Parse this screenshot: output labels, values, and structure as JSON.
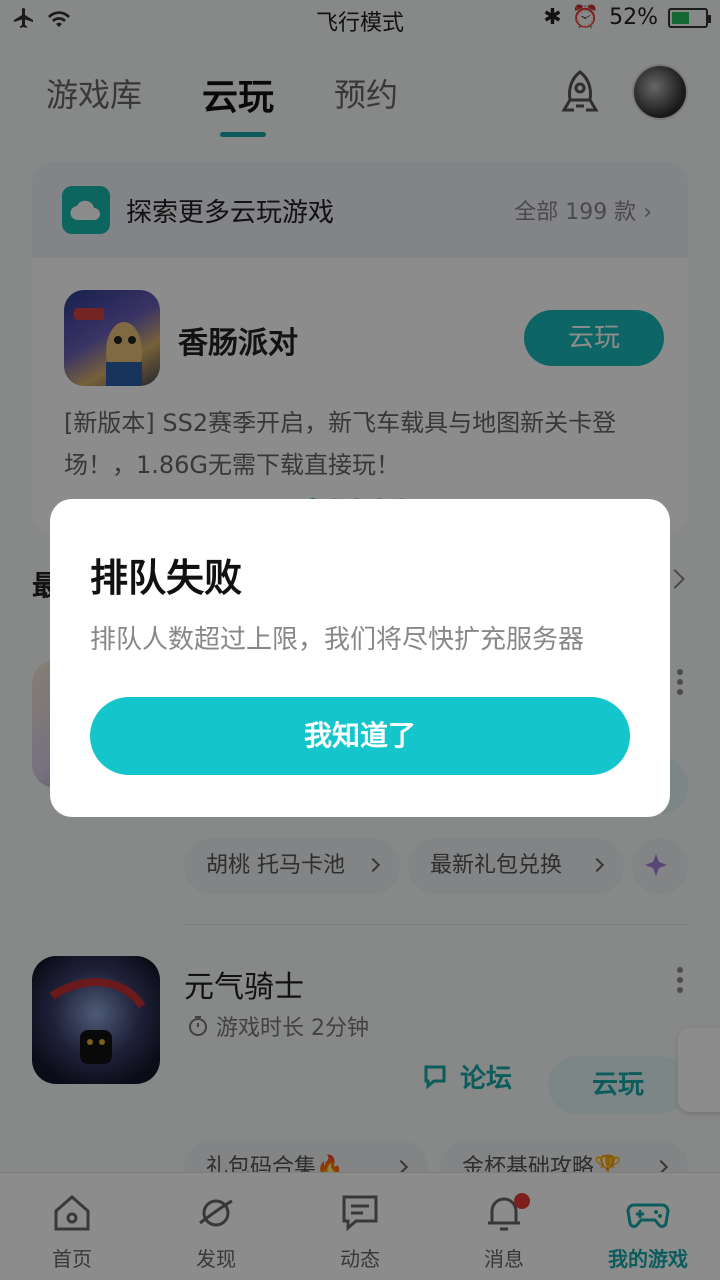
{
  "status_bar": {
    "center_text": "飞行模式",
    "battery": "52%"
  },
  "header": {
    "tabs": [
      {
        "label": "游戏库"
      },
      {
        "label": "云玩"
      },
      {
        "label": "预约"
      }
    ]
  },
  "cloud_card": {
    "title": "探索更多云玩游戏",
    "all_label": "全部 199 款",
    "game_name": "香肠派对",
    "play_label": "云玩",
    "description": "[新版本] SS2赛季开启，新飞车载具与地图新关卡登场！，1.86G无需下载直接玩！"
  },
  "recent": {
    "title_fragment": "最",
    "game1_chips": [
      "胡桃 托马卡池",
      "最新礼包兑换"
    ],
    "game2": {
      "name": "元气骑士",
      "time": "游戏时长 2分钟",
      "forum_label": "论坛",
      "play_label": "云玩",
      "chips": [
        "礼包码合集🔥",
        "金杯基础攻略🏆"
      ]
    }
  },
  "bottom_nav": [
    {
      "label": "首页"
    },
    {
      "label": "发现"
    },
    {
      "label": "动态"
    },
    {
      "label": "消息"
    },
    {
      "label": "我的游戏"
    }
  ],
  "dialog": {
    "title": "排队失败",
    "message": "排队人数超过上限，我们将尽快扩充服务器",
    "button_label": "我知道了"
  },
  "colors": {
    "accent": "#19b8b8",
    "dialog_button": "#14c6cc",
    "badge": "#e53935"
  }
}
